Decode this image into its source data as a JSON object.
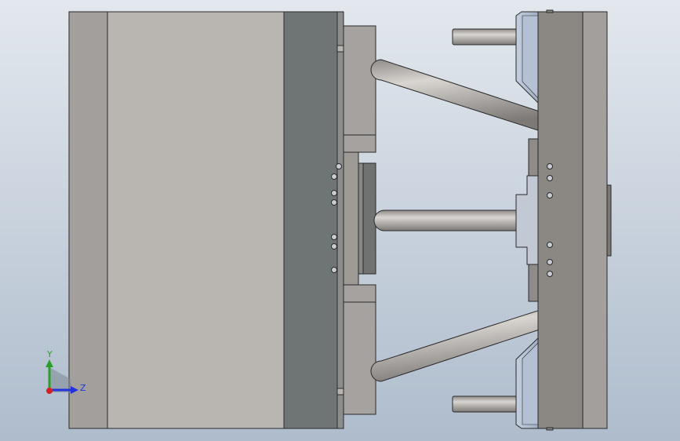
{
  "viewport": {
    "background_top": "#e3e8ee",
    "background_bottom": "#aebccc"
  },
  "axis_triad": {
    "y_label": "Y",
    "z_label": "Z",
    "y_color": "#2aa02a",
    "z_color": "#2233dd",
    "origin_color": "#d42020"
  },
  "colors": {
    "outline": "#2a2a2a",
    "plate_light": "#b7b3af",
    "plate_mid": "#a29f9c",
    "plate_dark": "#6f7574",
    "ejector_blue": "#a8b6cc",
    "rod": "#bdbab6"
  }
}
